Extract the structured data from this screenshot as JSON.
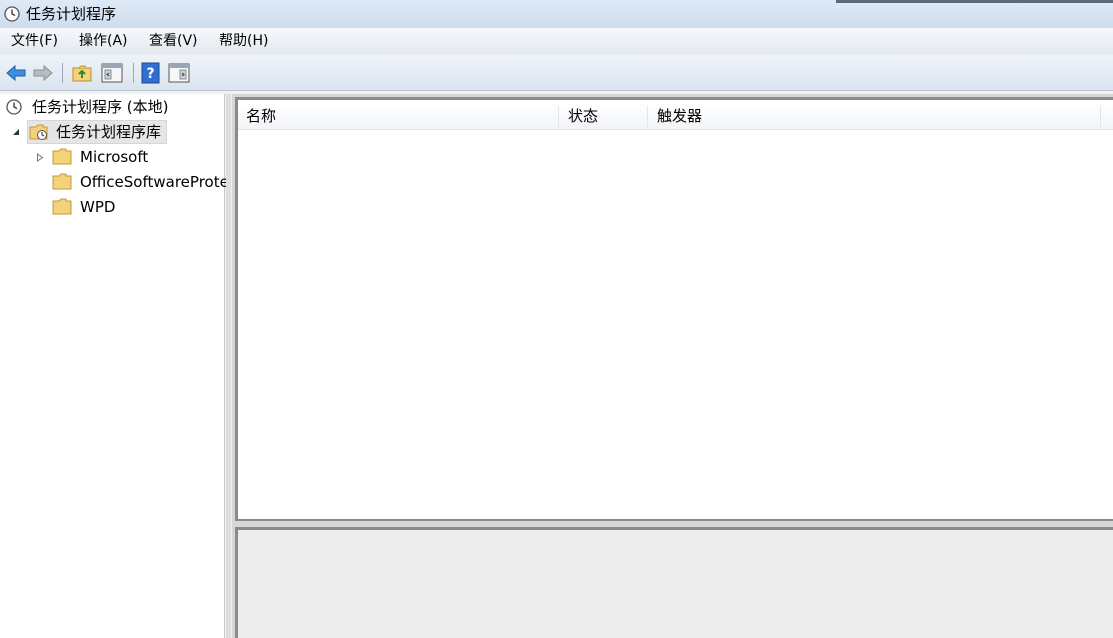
{
  "window": {
    "title": "任务计划程序",
    "icon": "clock-icon"
  },
  "menu": [
    {
      "label": "文件(F)"
    },
    {
      "label": "操作(A)"
    },
    {
      "label": "查看(V)"
    },
    {
      "label": "帮助(H)"
    }
  ],
  "toolbar": {
    "buttons": [
      {
        "name": "back-arrow-icon"
      },
      {
        "name": "forward-arrow-icon"
      },
      {
        "name": "up-folder-icon"
      },
      {
        "name": "show-hide-console-tree-icon"
      },
      {
        "name": "help-icon"
      },
      {
        "name": "show-hide-action-pane-icon"
      }
    ]
  },
  "tree": {
    "root": "任务计划程序 (本地)",
    "library": "任务计划程序库",
    "children": [
      {
        "label": "Microsoft",
        "expandable": true
      },
      {
        "label": "OfficeSoftwareProte",
        "expandable": false
      },
      {
        "label": "WPD",
        "expandable": false
      }
    ]
  },
  "list": {
    "columns": [
      {
        "label": "名称"
      },
      {
        "label": "状态"
      },
      {
        "label": "触发器"
      }
    ],
    "rows": []
  },
  "colors": {
    "folder": "#f3d27a",
    "accent_blue": "#2f7fd8"
  }
}
